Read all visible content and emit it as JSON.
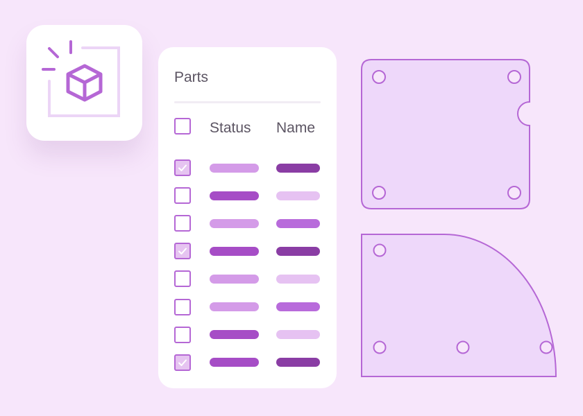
{
  "app_icon": {
    "name": "box-icon"
  },
  "parts": {
    "title": "Parts",
    "columns": {
      "status": "Status",
      "name": "Name"
    },
    "select_all_checked": false,
    "rows": [
      {
        "checked": true,
        "status_color": "#d49be8",
        "name_color": "#8a3da4"
      },
      {
        "checked": false,
        "status_color": "#a64dc6",
        "name_color": "#e6c2f2"
      },
      {
        "checked": false,
        "status_color": "#d49be8",
        "name_color": "#b86bdb"
      },
      {
        "checked": true,
        "status_color": "#a64dc6",
        "name_color": "#8a3da4"
      },
      {
        "checked": false,
        "status_color": "#d49be8",
        "name_color": "#e6c2f2"
      },
      {
        "checked": false,
        "status_color": "#d49be8",
        "name_color": "#b86bdb"
      },
      {
        "checked": false,
        "status_color": "#a64dc6",
        "name_color": "#e6c2f2"
      },
      {
        "checked": true,
        "status_color": "#a64dc6",
        "name_color": "#8a3da4"
      }
    ]
  },
  "colors": {
    "background": "#f7e6fb",
    "accent": "#b567d5",
    "part_fill": "#eed8fa",
    "check_fill": "#e6c4f1"
  },
  "part_shapes": [
    "rounded-plate-with-notch",
    "quarter-round-plate"
  ]
}
